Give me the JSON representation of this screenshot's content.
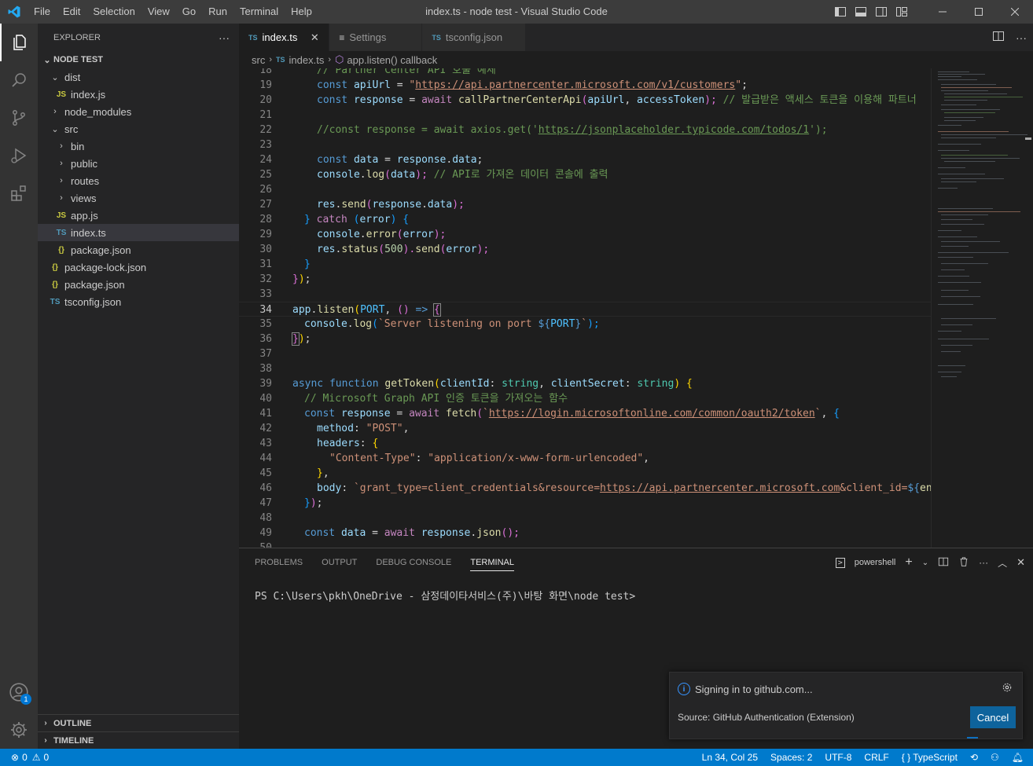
{
  "titlebar": {
    "title": "index.ts - node test - Visual Studio Code",
    "menu": [
      "File",
      "Edit",
      "Selection",
      "View",
      "Go",
      "Run",
      "Terminal",
      "Help"
    ]
  },
  "activity": {
    "accounts_badge": "1"
  },
  "explorer": {
    "header": "EXPLORER",
    "more": "···",
    "root": "NODE TEST",
    "tree": [
      {
        "label": "dist",
        "type": "folder",
        "open": true
      },
      {
        "label": "index.js",
        "type": "js",
        "icon": "JS"
      },
      {
        "label": "node_modules",
        "type": "folder",
        "open": false
      },
      {
        "label": "src",
        "type": "folder",
        "open": true
      },
      {
        "label": "bin",
        "type": "folder",
        "open": false
      },
      {
        "label": "public",
        "type": "folder",
        "open": false
      },
      {
        "label": "routes",
        "type": "folder",
        "open": false
      },
      {
        "label": "views",
        "type": "folder",
        "open": false
      },
      {
        "label": "app.js",
        "type": "js",
        "icon": "JS"
      },
      {
        "label": "index.ts",
        "type": "ts",
        "icon": "TS"
      },
      {
        "label": "package.json",
        "type": "json",
        "icon": "{}"
      },
      {
        "label": "package-lock.json",
        "type": "json",
        "icon": "{}"
      },
      {
        "label": "package.json",
        "type": "json",
        "icon": "{}"
      },
      {
        "label": "tsconfig.json",
        "type": "ts",
        "icon": "TS"
      }
    ],
    "outline": "OUTLINE",
    "timeline": "TIMELINE"
  },
  "tabs": [
    {
      "label": "index.ts",
      "icon": "TS",
      "close": "✕"
    },
    {
      "label": "Settings",
      "icon": "≡"
    },
    {
      "label": "tsconfig.json",
      "icon": "TS"
    }
  ],
  "breadcrumb": {
    "folder": "src",
    "file_icon": "TS",
    "file": "index.ts",
    "symbol": "app.listen() callback"
  },
  "code": {
    "line_numbers": [
      "18",
      "19",
      "20",
      "21",
      "22",
      "23",
      "24",
      "25",
      "26",
      "27",
      "28",
      "29",
      "30",
      "31",
      "32",
      "33",
      "34",
      "35",
      "36",
      "37",
      "38",
      "39",
      "40",
      "41",
      "42",
      "43",
      "44",
      "45",
      "46",
      "47",
      "48",
      "49",
      "50"
    ],
    "current_line": "34",
    "l18_comment": "// Partner Center API 호출 예제",
    "l19_kw": "const",
    "l19_var": "apiUrl",
    "l19_eq": " = ",
    "l19_q1": "\"",
    "l19_url": "https://api.partnercenter.microsoft.com/v1/customers",
    "l19_q2": "\"",
    "l19_end": ";",
    "l20_kw": "const",
    "l20_var": "response",
    "l20_eq": " = ",
    "l20_await": "await",
    "l20_fn": "callPartnerCenterApi",
    "l20_p1": "(",
    "l20_a1": "apiUrl",
    "l20_comma": ", ",
    "l20_a2": "accessToken",
    "l20_p2": ");",
    "l20_comment": " // 발급받은 액세스 토큰을 이용해 파트너",
    "l22_comment_pre": "//const response = await axios.get('",
    "l22_comment_url": "https://jsonplaceholder.typicode.com/todos/1",
    "l22_comment_post": "');",
    "l24_kw": "const",
    "l24_var": "data",
    "l24_eq": " = ",
    "l24_obj": "response",
    "l24_dot": ".",
    "l24_prop": "data",
    "l24_end": ";",
    "l25_obj": "console",
    "l25_dot": ".",
    "l25_fn": "log",
    "l25_p1": "(",
    "l25_arg": "data",
    "l25_p2": ");",
    "l25_comment": " // API로 가져온 데이터 콘솔에 출력",
    "l27_obj": "res",
    "l27_dot": ".",
    "l27_fn": "send",
    "l27_p1": "(",
    "l27_a1": "response",
    "l27_a1dot": ".",
    "l27_a2": "data",
    "l27_p2": ");",
    "l28_brace": "}",
    "l28_catch": " catch ",
    "l28_p1": "(",
    "l28_err": "error",
    "l28_p2": ")",
    "l28_sp": " ",
    "l28_open": "{",
    "l29_obj": "console",
    "l29_dot": ".",
    "l29_fn": "error",
    "l29_p1": "(",
    "l29_arg": "error",
    "l29_p2": ");",
    "l30_obj": "res",
    "l30_dot": ".",
    "l30_fn": "status",
    "l30_p1": "(",
    "l30_num": "500",
    "l30_p2": ").",
    "l30_fn2": "send",
    "l30_p3": "(",
    "l30_arg": "error",
    "l30_p4": ");",
    "l31_close": "}",
    "l32_brace": "}",
    "l32_paren": ")",
    "l32_semi": ";",
    "l34_obj": "app",
    "l34_dot": ".",
    "l34_fn": "listen",
    "l34_p1": "(",
    "l34_const": "PORT",
    "l34_comma": ", ",
    "l34_p2": "()",
    "l34_arrow": " => ",
    "l34_open": "{",
    "l35_obj": "console",
    "l35_dot": ".",
    "l35_fn": "log",
    "l35_p1": "(",
    "l35_str1": "`Server listening on port ",
    "l35_tpl1": "${",
    "l35_const": "PORT",
    "l35_tpl2": "}",
    "l35_str2": "`",
    "l35_p2": ");",
    "l36_close": "}",
    "l36_paren": ")",
    "l36_semi": ";",
    "l39_async": "async",
    "l39_function": " function ",
    "l39_fn": "getToken",
    "l39_p1": "(",
    "l39_a1": "clientId",
    "l39_colon1": ": ",
    "l39_t1": "string",
    "l39_comma": ", ",
    "l39_a2": "clientSecret",
    "l39_colon2": ": ",
    "l39_t2": "string",
    "l39_p2": ")",
    "l39_sp": " ",
    "l39_open": "{",
    "l40_comment": "// Microsoft Graph API 인증 토큰을 가져오는 함수",
    "l41_kw": "const",
    "l41_var": "response",
    "l41_eq": " = ",
    "l41_await": "await",
    "l41_fn": "fetch",
    "l41_p1": "(",
    "l41_q1": "`",
    "l41_url": "https://login.microsoftonline.com/common/oauth2/token",
    "l41_q2": "`",
    "l41_comma": ", ",
    "l41_open": "{",
    "l42_key": "method",
    "l42_colon": ": ",
    "l42_val": "\"POST\"",
    "l42_comma": ",",
    "l43_key": "headers",
    "l43_colon": ": ",
    "l43_open": "{",
    "l44_key": "\"Content-Type\"",
    "l44_colon": ": ",
    "l44_val": "\"application/x-www-form-urlencoded\"",
    "l44_comma": ",",
    "l45_close": "}",
    "l45_comma": ",",
    "l46_key": "body",
    "l46_colon": ": ",
    "l46_str1": "`grant_type=client_credentials&resource=",
    "l46_url": "https://api.partnercenter.microsoft.com",
    "l46_str2": "&client_id=",
    "l46_tpl": "${",
    "l46_fn": "enco",
    "l47_close": "}",
    "l47_paren": ")",
    "l47_semi": ";",
    "l49_kw": "const",
    "l49_var": "data",
    "l49_eq": " = ",
    "l49_await": "await",
    "l49_obj": "response",
    "l49_dot": ".",
    "l49_fn": "json",
    "l49_p": "();"
  },
  "panel": {
    "tabs": [
      "PROBLEMS",
      "OUTPUT",
      "DEBUG CONSOLE",
      "TERMINAL"
    ],
    "active_tab": "TERMINAL",
    "shell": "powershell",
    "terminal_text": "PS C:\\Users\\pkh\\OneDrive - 삼정데이타서비스(주)\\바탕 화면\\node test>"
  },
  "notification": {
    "message": "Signing in to github.com...",
    "source": "Source: GitHub Authentication (Extension)",
    "button": "Cancel"
  },
  "statusbar": {
    "errors": "0",
    "warnings": "0",
    "position": "Ln 34, Col 25",
    "spaces": "Spaces: 2",
    "encoding": "UTF-8",
    "eol": "CRLF",
    "language_braces": "{ }",
    "language": "TypeScript"
  },
  "colors": {
    "accent": "#007acc",
    "titlebar": "#3c3c3c",
    "activitybar": "#333333",
    "sidebar": "#252526",
    "editor": "#1e1e1e",
    "button": "#0e639c"
  }
}
